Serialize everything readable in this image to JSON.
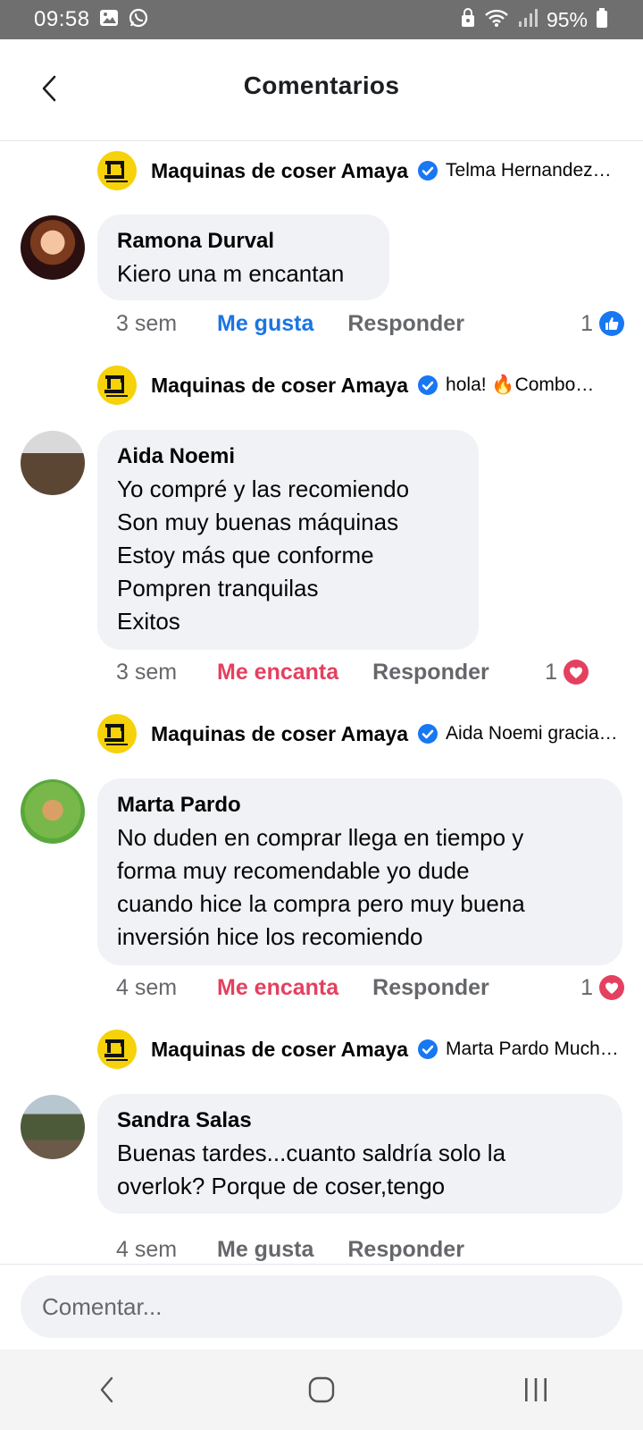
{
  "status": {
    "time": "09:58",
    "battery": "95%"
  },
  "header": {
    "title": "Comentarios"
  },
  "page_author": "Maquinas de coser Amaya",
  "threads": [
    {
      "reply_snippet": "Telma Hernandez…"
    },
    {
      "author": "Ramona Durval",
      "text": "Kiero una m encantan",
      "time": "3 sem",
      "reaction_label": "Me gusta",
      "reply_label": "Responder",
      "reaction_count": "1",
      "reply_snippet": "hola! 🔥Combo…"
    },
    {
      "author": "Aida Noemi",
      "text": "Yo compré y las recomiendo\nSon muy buenas máquinas\nEstoy más que conforme\nPompren tranquilas\nExitos",
      "time": "3 sem",
      "reaction_label": "Me encanta",
      "reply_label": "Responder",
      "reaction_count": "1",
      "reply_snippet": "Aida Noemi gracias…"
    },
    {
      "author": "Marta Pardo",
      "text": "No duden en comprar llega en tiempo y\nforma muy recomendable yo dude\ncuando hice la compra pero muy buena\ninversión hice los recomiendo",
      "time": "4 sem",
      "reaction_label": "Me encanta",
      "reply_label": "Responder",
      "reaction_count": "1",
      "reply_snippet": "Marta Pardo Muchas…"
    },
    {
      "author": "Sandra Salas",
      "text": "Buenas tardes...cuanto saldría solo la\noverlok? Porque de coser,tengo",
      "time": "4 sem",
      "reaction_label": "Me gusta",
      "reply_label": "Responder"
    }
  ],
  "composer": {
    "placeholder": "Comentar..."
  },
  "colors": {
    "like": "#1b74e4",
    "love": "#e4405f",
    "verified": "#1877f2",
    "bubble": "#f0f2f5"
  }
}
